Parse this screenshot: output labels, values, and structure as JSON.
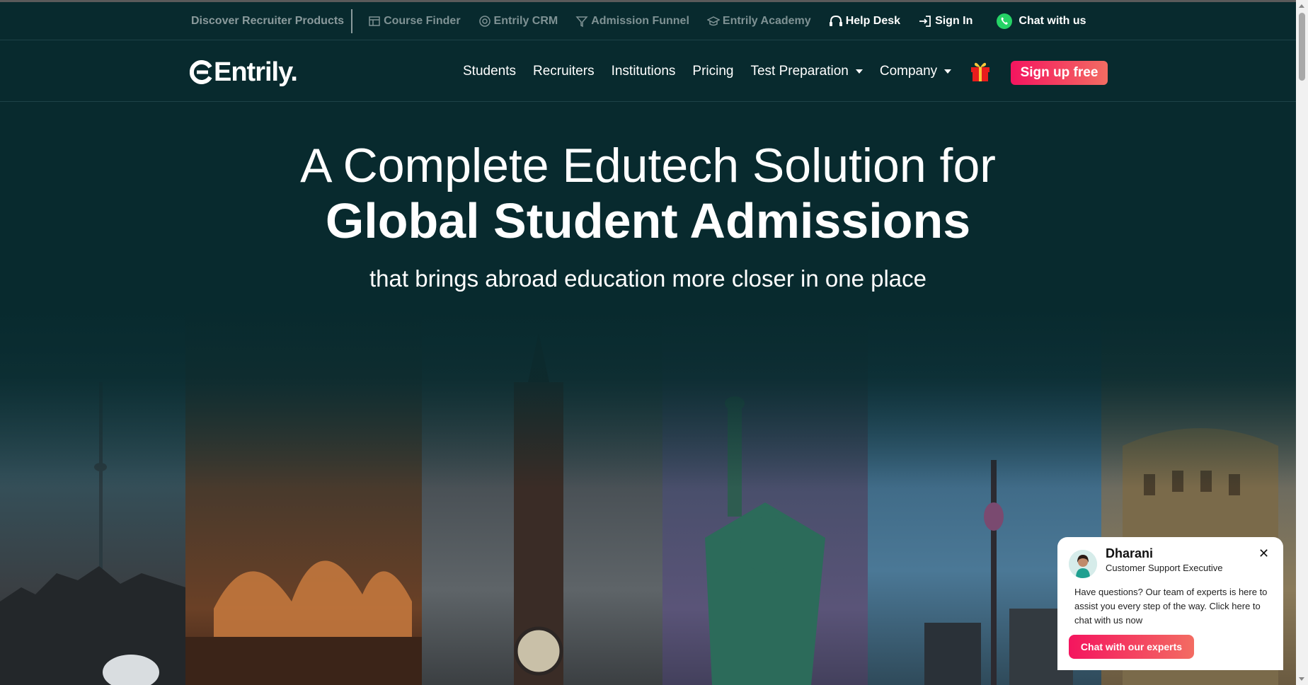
{
  "utility_bar": {
    "label": "Discover Recruiter Products",
    "links": [
      {
        "label": "Course Finder",
        "icon": "course-finder-icon"
      },
      {
        "label": "Entrily CRM",
        "icon": "crm-icon"
      },
      {
        "label": "Admission Funnel",
        "icon": "funnel-icon"
      },
      {
        "label": "Entrily Academy",
        "icon": "graduation-cap-icon"
      },
      {
        "label": "Help Desk",
        "icon": "headset-icon"
      },
      {
        "label": "Sign In",
        "icon": "sign-in-icon"
      },
      {
        "label": "Chat with us",
        "icon": "whatsapp-icon"
      }
    ]
  },
  "nav": {
    "logo": "Entrily.",
    "items": [
      "Students",
      "Recruiters",
      "Institutions",
      "Pricing",
      "Test Preparation",
      "Company"
    ],
    "signup_label": "Sign up free"
  },
  "hero": {
    "line1": "A Complete Edutech Solution for",
    "line2": "Global Student Admissions",
    "subtitle": "that brings abroad education more closer in one place"
  },
  "chat_widget": {
    "name": "Dharani",
    "role": "Customer Support Executive",
    "message": "Have questions? Our team of experts is here to assist you every step of the way. Click here to chat with us now",
    "button": "Chat with our experts"
  },
  "colors": {
    "background": "#082a2e",
    "accent_start": "#f4155f",
    "accent_end": "#f36c62",
    "whatsapp": "#25d366"
  }
}
